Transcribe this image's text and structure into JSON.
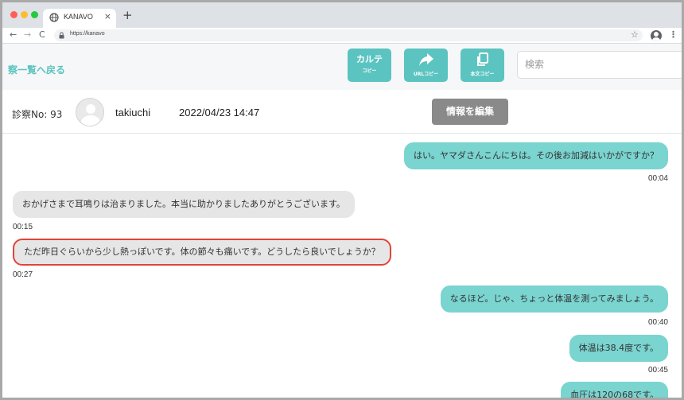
{
  "browser": {
    "tab_title": "KANAVO",
    "tab_close": "×",
    "new_tab": "+",
    "url": "https://kanavo",
    "back": "←",
    "forward": "→",
    "reload": "C",
    "star": "☆",
    "menu": "⋮"
  },
  "header": {
    "back_link": "察一覧へ戻る",
    "buttons": [
      {
        "label": "カルテ",
        "sublabel": "コピー",
        "icon": "text"
      },
      {
        "label": "",
        "sublabel": "URLコピー",
        "icon": "share-arrow-icon"
      },
      {
        "label": "",
        "sublabel": "本文コピー",
        "icon": "copy-icon"
      }
    ],
    "search_placeholder": "検索",
    "accent_color": "#5bc4c0"
  },
  "info": {
    "record_no": "診察No: 93",
    "user_name": "takiuchi",
    "datetime": "2022/04/23 14:47",
    "edit_button": "情報を編集"
  },
  "messages": [
    {
      "sender": "doctor",
      "text": "はい。ヤマダさんこんにちは。その後お加減はいかがですか？",
      "time": "00:04"
    },
    {
      "sender": "patient",
      "text": "おかげさまで耳鳴りは治まりました。本当に助かりましたありがとうございます。",
      "time": "00:15"
    },
    {
      "sender": "patient",
      "text": "ただ昨日ぐらいから少し熱っぽいです。体の節々も痛いです。どうしたら良いでしょうか？",
      "time": "00:27",
      "highlighted": true
    },
    {
      "sender": "doctor",
      "text": "なるほど。じゃ、ちょっと体温を測ってみましょう。",
      "time": "00:40"
    },
    {
      "sender": "doctor",
      "text": "体温は38.4度です。",
      "time": "00:45"
    },
    {
      "sender": "doctor",
      "text": "血圧は120の68です。",
      "time": ""
    }
  ]
}
